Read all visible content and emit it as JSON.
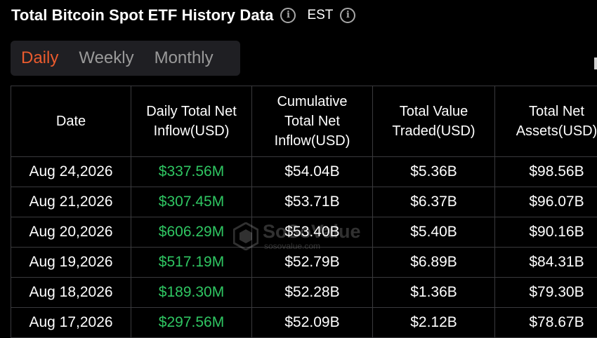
{
  "header": {
    "title": "Total Bitcoin Spot ETF History Data",
    "timezone": "EST",
    "info_icon": "info-circle-icon"
  },
  "tabs": [
    {
      "label": "Daily",
      "active": true
    },
    {
      "label": "Weekly",
      "active": false
    },
    {
      "label": "Monthly",
      "active": false
    }
  ],
  "table": {
    "columns": [
      "Date",
      "Daily Total Net Inflow(USD)",
      "Cumulative Total Net Inflow(USD)",
      "Total Value Traded(USD)",
      "Total Net Assets(USD)"
    ],
    "rows": [
      [
        "Aug 24,2026",
        "$337.56M",
        "$54.04B",
        "$5.36B",
        "$98.56B"
      ],
      [
        "Aug 21,2026",
        "$307.45M",
        "$53.71B",
        "$6.37B",
        "$96.07B"
      ],
      [
        "Aug 20,2026",
        "$606.29M",
        "$53.40B",
        "$5.40B",
        "$90.16B"
      ],
      [
        "Aug 19,2026",
        "$517.19M",
        "$52.79B",
        "$6.89B",
        "$84.31B"
      ],
      [
        "Aug 18,2026",
        "$189.30M",
        "$52.28B",
        "$1.36B",
        "$79.30B"
      ],
      [
        "Aug 17,2026",
        "$297.56M",
        "$52.09B",
        "$2.12B",
        "$78.67B"
      ]
    ]
  },
  "watermark": {
    "name": "SoSoValue",
    "url": "sosovalue.com"
  },
  "colors": {
    "background": "#000000",
    "accent_active_tab": "#ea5b2e",
    "inflow_positive": "#2fc662",
    "grid_border": "#3a3a3d"
  }
}
